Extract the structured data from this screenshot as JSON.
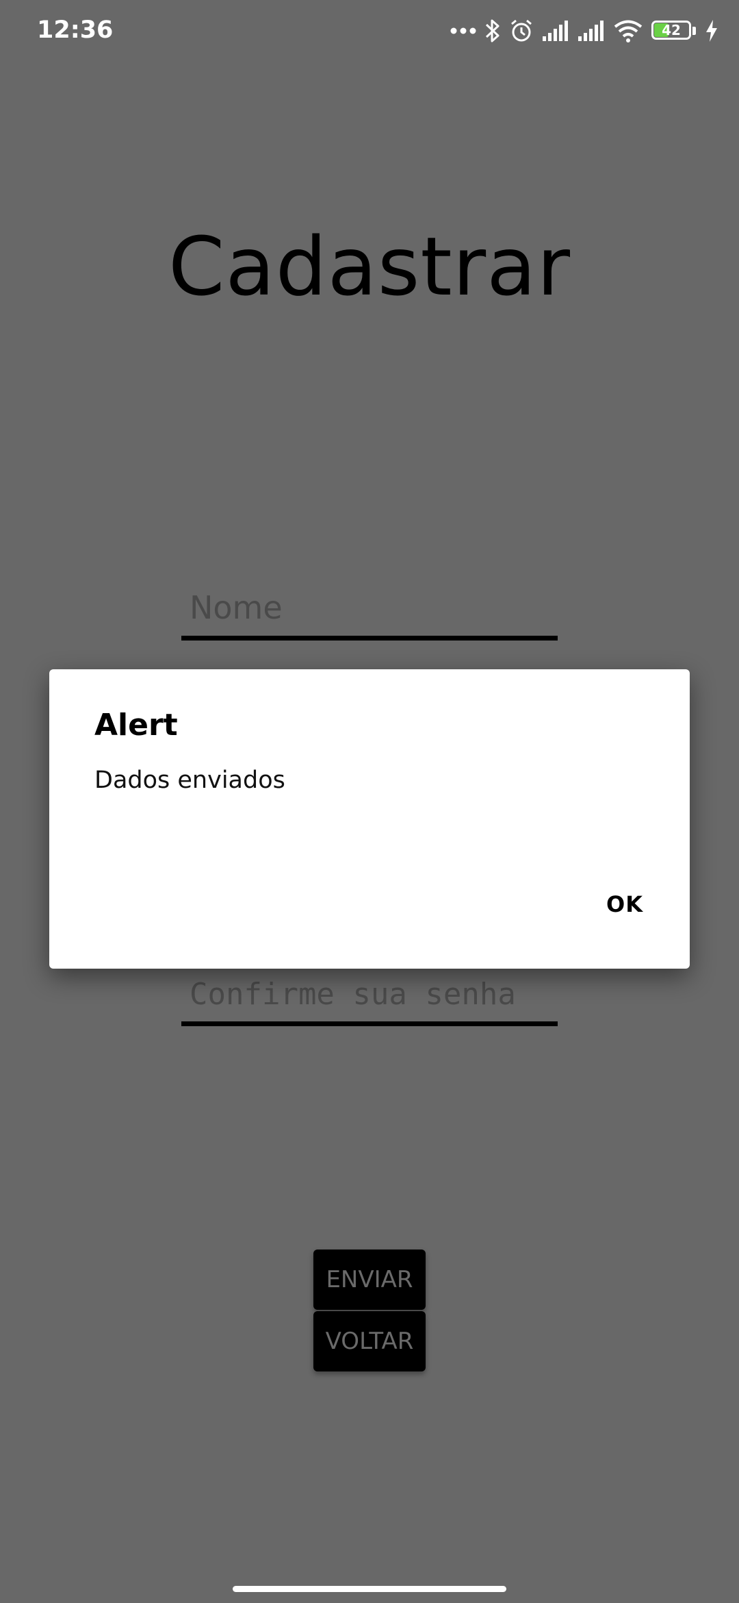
{
  "status_bar": {
    "time": "12:36",
    "battery_level": "42",
    "battery_fraction": 0.42,
    "icons": [
      "more-dots-icon",
      "bluetooth-icon",
      "alarm-icon",
      "signal-icon",
      "signal-icon",
      "wifi-icon",
      "battery-icon",
      "charging-icon"
    ]
  },
  "form": {
    "title": "Cadastrar",
    "name_placeholder": "Nome",
    "confirm_password_placeholder": "Confirme sua senha",
    "send_button": "ENVIAR",
    "back_button": "VOLTAR"
  },
  "dialog": {
    "title": "Alert",
    "message": "Dados enviados",
    "ok_button": "OK"
  },
  "colors": {
    "background_dim": "#686868",
    "battery_fill": "#6ad046"
  }
}
